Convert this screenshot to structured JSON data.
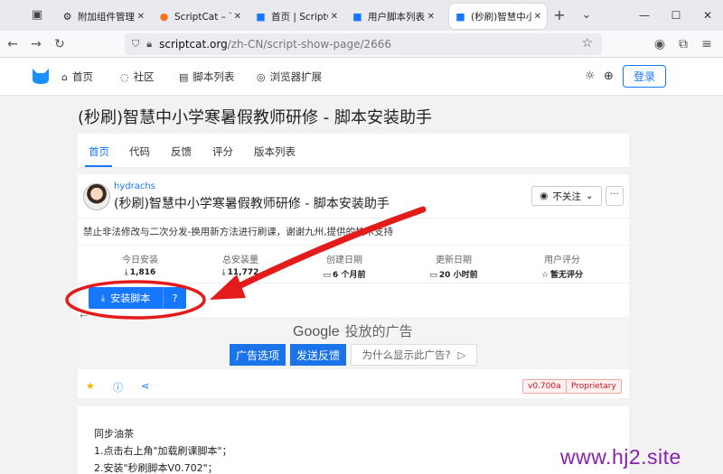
{
  "browser": {
    "tabs": [
      {
        "title": "附加组件管理器",
        "favicon": "puzzle-icon",
        "active": false
      },
      {
        "title": "ScriptCat – 下载",
        "favicon": "firefox-icon",
        "active": false
      },
      {
        "title": "首页 | ScriptCat",
        "favicon": "scriptcat-icon",
        "active": false
      },
      {
        "title": "用户脚本列表 -",
        "favicon": "scriptcat-icon",
        "active": false
      },
      {
        "title": "(秒刷)智慧中小",
        "favicon": "scriptcat-icon",
        "active": true
      }
    ],
    "url_host": "scriptcat.org",
    "url_path": "/zh-CN/script-show-page/2666"
  },
  "site": {
    "nav": [
      {
        "label": "首页",
        "icon": "home-icon"
      },
      {
        "label": "社区",
        "icon": "chat-icon"
      },
      {
        "label": "脚本列表",
        "icon": "list-icon"
      },
      {
        "label": "浏览器扩展",
        "icon": "chrome-icon"
      }
    ],
    "login_label": "登录"
  },
  "page": {
    "title": "(秒刷)智慧中小学寒暑假教师研修 - 脚本安装助手",
    "tabs": [
      "首页",
      "代码",
      "反馈",
      "评分",
      "版本列表"
    ],
    "author": "hydrachs",
    "script_name": "(秒刷)智慧中小学寒暑假教师研修 - 脚本安装助手",
    "follow_label": "不关注",
    "more_label": "···",
    "description": "禁止非法修改与二次分发-换用新方法进行刷课，谢谢九州,提供的技术支持",
    "stats": [
      {
        "label": "今日安装",
        "value": "1,816",
        "icon": "download-icon"
      },
      {
        "label": "总安装量",
        "value": "11,772",
        "icon": "download-icon"
      },
      {
        "label": "创建日期",
        "value": "6 个月前",
        "icon": "calendar-icon"
      },
      {
        "label": "更新日期",
        "value": "20 小时前",
        "icon": "calendar-icon"
      },
      {
        "label": "用户评分",
        "value": "暂无评分",
        "icon": "star-icon"
      }
    ],
    "install_label": "安装脚本",
    "ad": {
      "brand": "Google",
      "text": "投放的广告",
      "options_label": "广告选项",
      "feedback_label": "发送反馈",
      "why_label": "为什么显示此广告?"
    },
    "version_tag": "v0.700a",
    "license_tag": "Proprietary",
    "content_lines": [
      "同步油茶",
      "1.点击右上角\"加载刷课脚本\"；",
      "2.安装\"秒刷脚本V0.702\"；"
    ]
  },
  "watermark": "www.hj2.site",
  "colors": {
    "accent": "#1677ff",
    "annotation": "#e31b1b",
    "watermark": "#8a1fb3"
  }
}
